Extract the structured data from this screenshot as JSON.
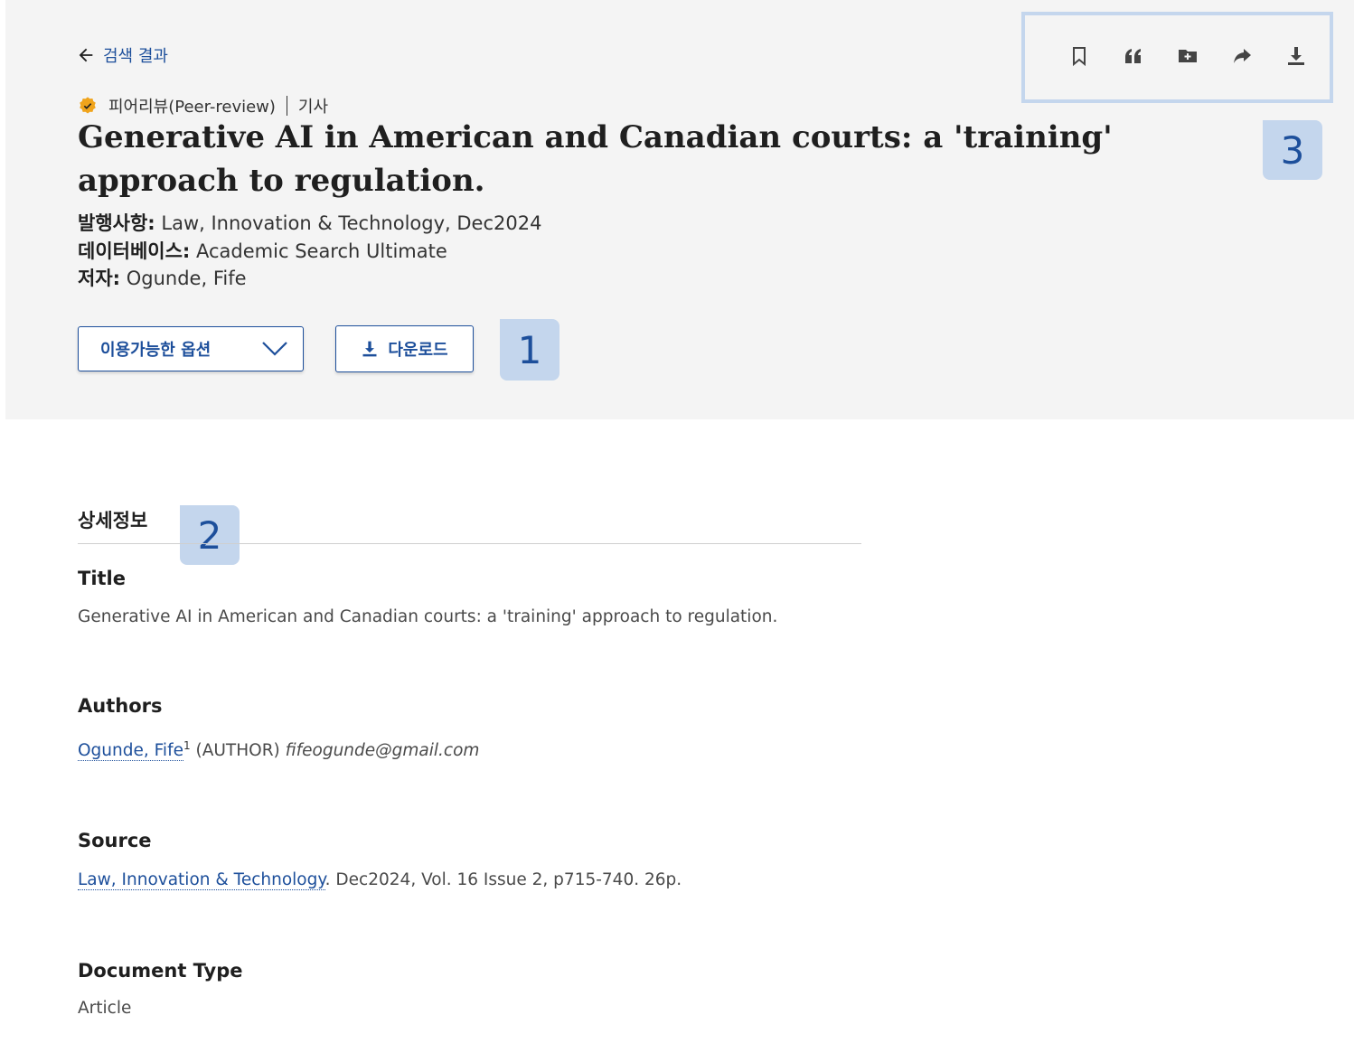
{
  "header": {
    "back_label": "검색 결과",
    "peer_review": "피어리뷰(Peer-review)",
    "doc_kind": "기사",
    "title": "Generative AI in American and Canadian courts: a 'training' approach to regulation.",
    "publication_label": "발행사항:",
    "publication_value": "Law, Innovation & Technology, Dec2024",
    "database_label": "데이터베이스:",
    "database_value": "Academic Search Ultimate",
    "author_label": "저자:",
    "author_value": "Ogunde, Fife"
  },
  "actions": {
    "options_label": "이용가능한 옵션",
    "download_label": "다운로드"
  },
  "toolbar": {
    "icons": [
      "bookmark-icon",
      "quote-icon",
      "add-folder-icon",
      "share-icon",
      "download-icon"
    ]
  },
  "badges": {
    "one": "1",
    "two": "2",
    "three": "3"
  },
  "details": {
    "section_title": "상세정보",
    "title_label": "Title",
    "title_value": "Generative AI in American and Canadian courts: a 'training' approach to regulation.",
    "authors_label": "Authors",
    "author_name": "Ogunde, Fife",
    "author_sup": "1",
    "author_role": "(AUTHOR)",
    "author_email": "fifeogunde@gmail.com",
    "source_label": "Source",
    "source_link": "Law, Innovation & Technology",
    "source_rest": ". Dec2024, Vol. 16 Issue 2, p715-740. 26p.",
    "doctype_label": "Document Type",
    "doctype_value": "Article"
  },
  "colors": {
    "accent": "#1d4f9b",
    "badge_bg": "#c4d6ed",
    "header_bg": "#f4f4f4",
    "peer_badge": "#f0a41c"
  }
}
